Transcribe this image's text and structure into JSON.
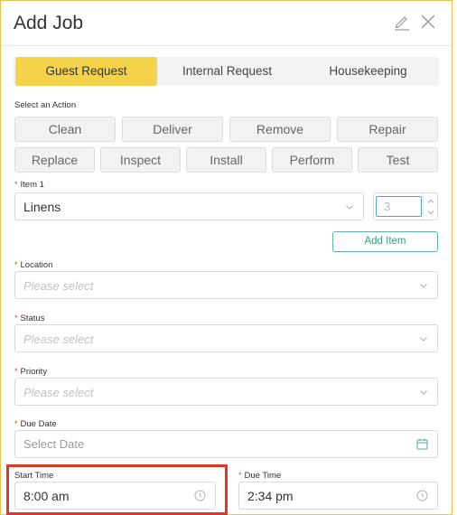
{
  "header": {
    "title": "Add Job"
  },
  "tabs": [
    {
      "label": "Guest Request",
      "active": true
    },
    {
      "label": "Internal Request",
      "active": false
    },
    {
      "label": "Housekeeping",
      "active": false
    }
  ],
  "actions": {
    "label": "Select an Action",
    "buttons": [
      "Clean",
      "Deliver",
      "Remove",
      "Repair",
      "Replace",
      "Inspect",
      "Install",
      "Perform",
      "Test"
    ]
  },
  "item": {
    "label": "Item 1",
    "value": "Linens",
    "quantity": "3",
    "add_label": "Add Item"
  },
  "location": {
    "label": "Location",
    "placeholder": "Please select"
  },
  "status": {
    "label": "Status",
    "placeholder": "Please select"
  },
  "priority": {
    "label": "Priority",
    "placeholder": "Please select"
  },
  "due_date": {
    "label": "Due Date",
    "placeholder": "Select Date"
  },
  "start_time": {
    "label": "Start Time",
    "value": "8:00 am"
  },
  "due_time": {
    "label": "Due Time",
    "value": "2:34 pm"
  },
  "required_marker": "*",
  "colors": {
    "accent": "#f4d34a",
    "teal": "#3a9a8a",
    "required": "#e0443d",
    "highlight": "#dc3a26"
  },
  "icons": [
    "edit-icon",
    "close-icon",
    "chevron-down-icon",
    "calendar-icon",
    "clock-icon"
  ]
}
